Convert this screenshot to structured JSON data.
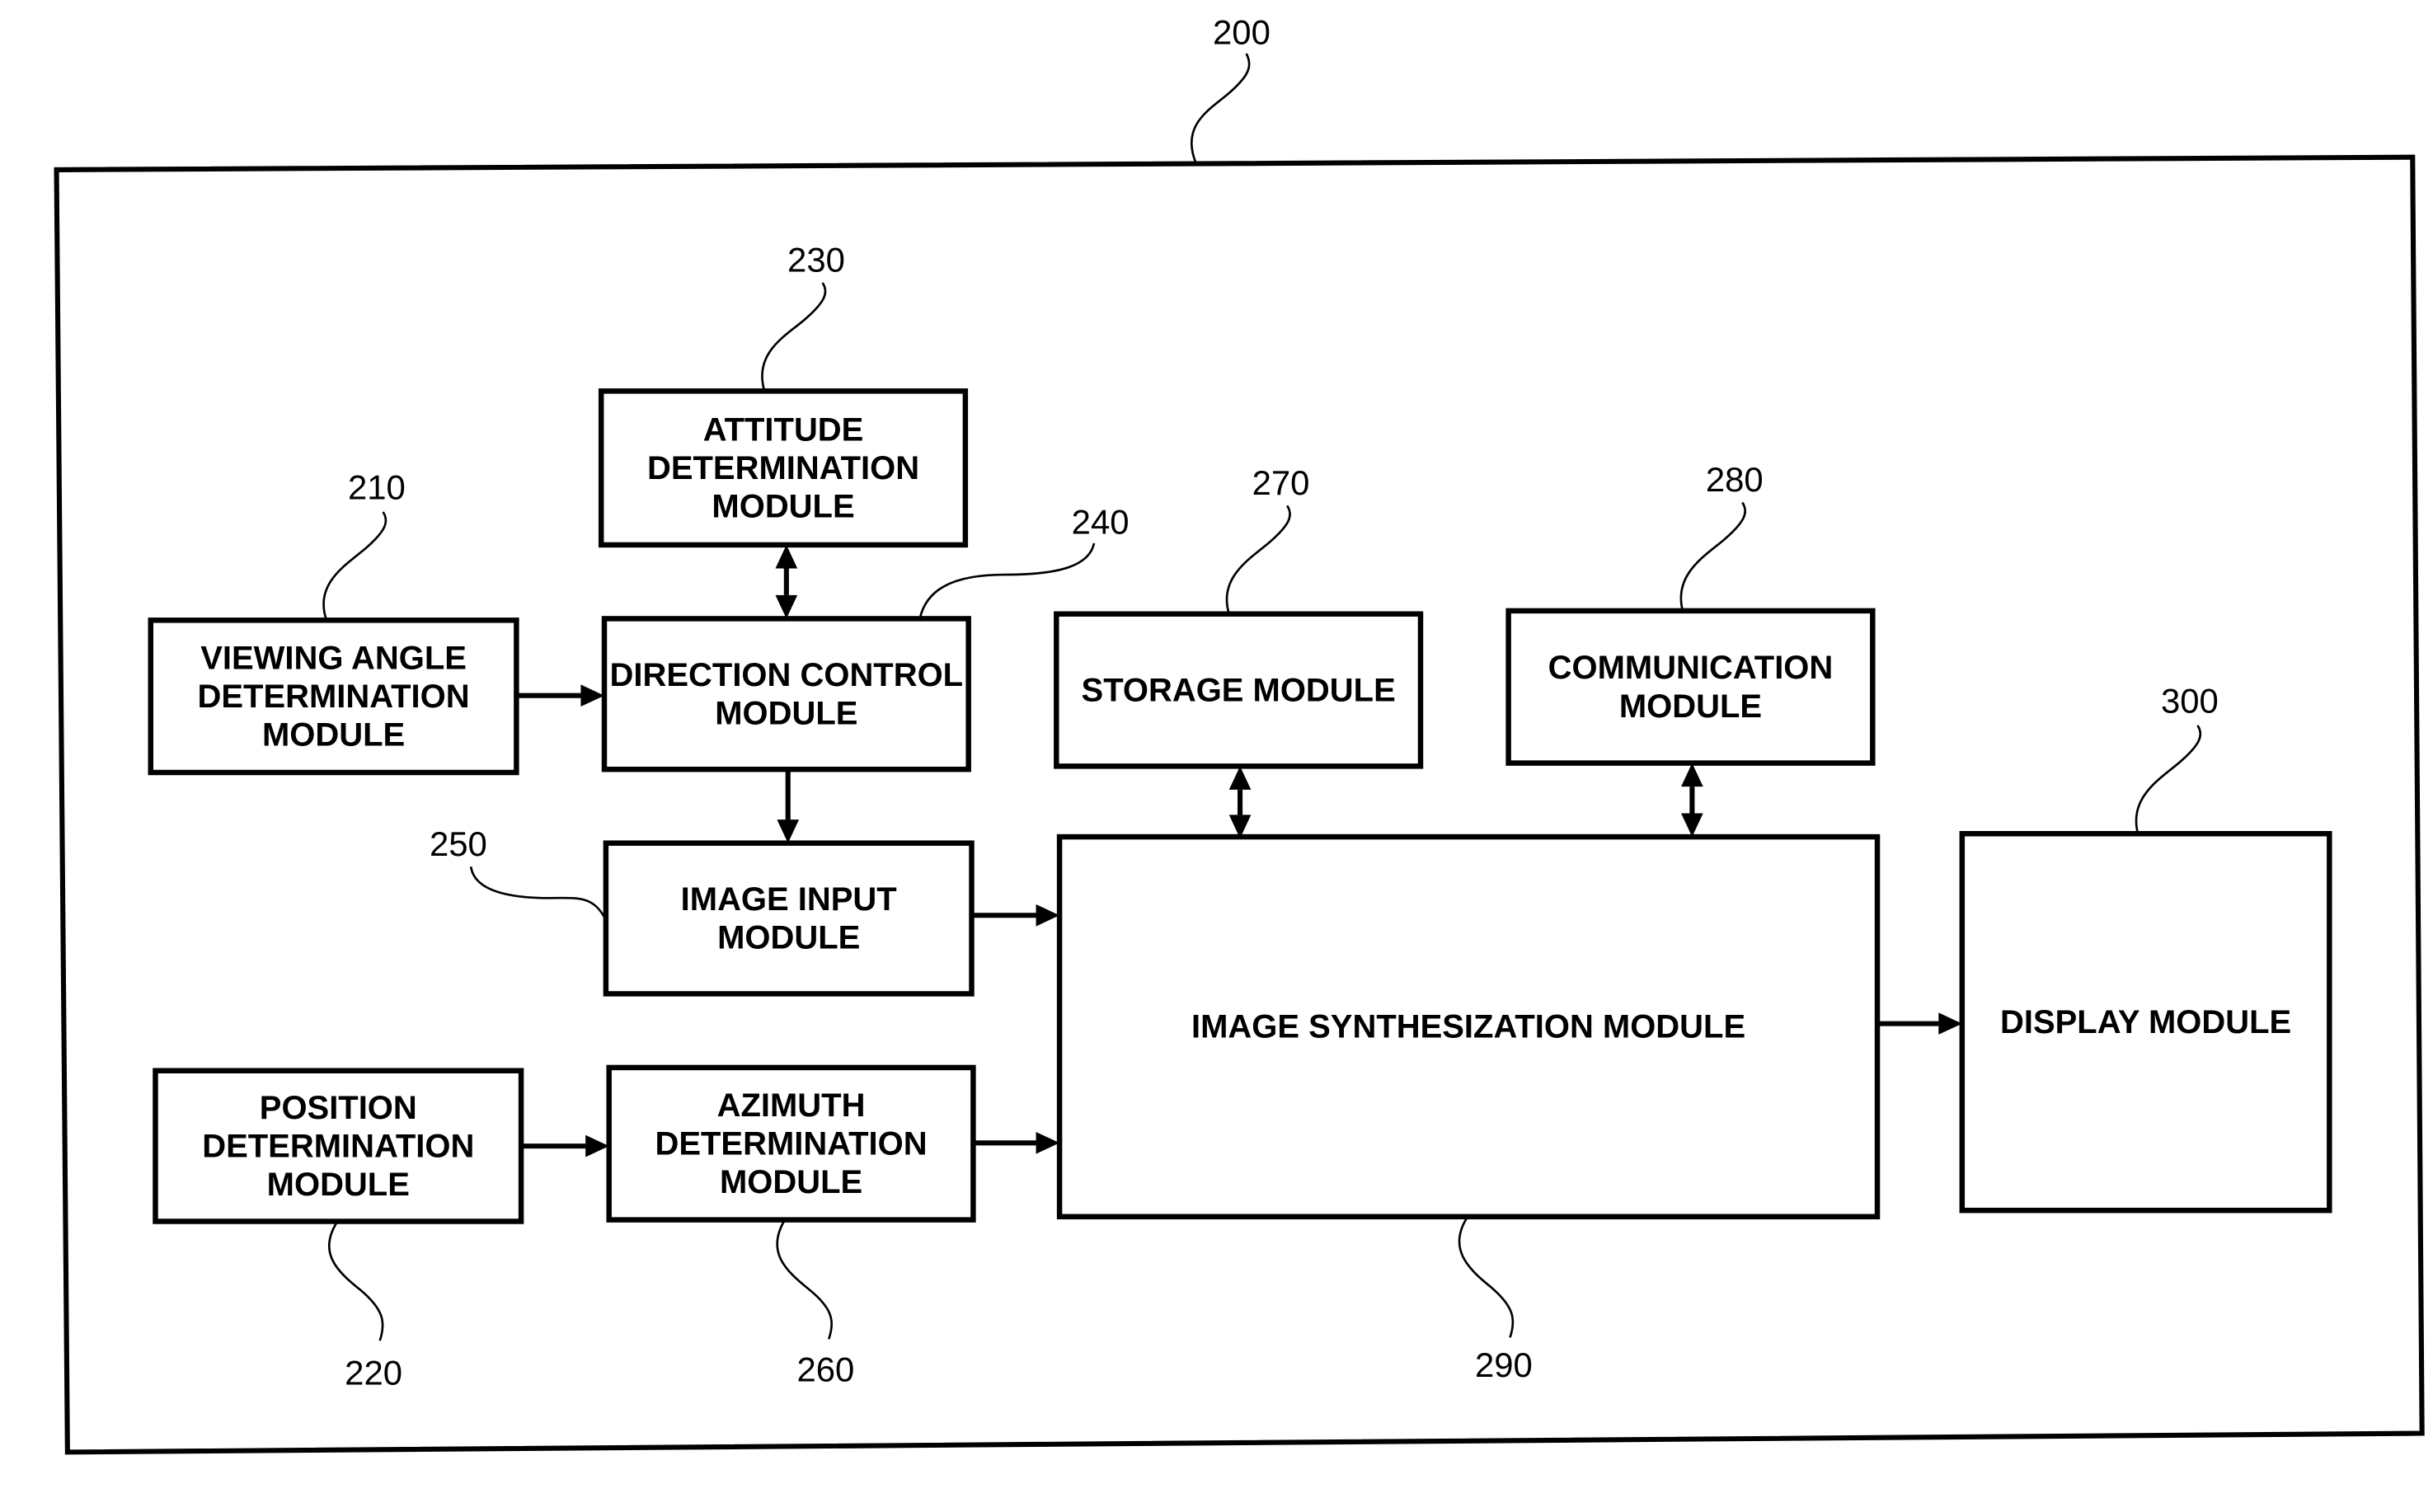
{
  "diagram": {
    "type": "block-diagram",
    "system": {
      "ref": "200"
    },
    "modules": [
      {
        "id": "attitude",
        "ref": "230",
        "lines": [
          "ATTITUDE",
          "DETERMINATION",
          "MODULE"
        ]
      },
      {
        "id": "viewing-angle",
        "ref": "210",
        "lines": [
          "VIEWING ANGLE",
          "DETERMINATION",
          "MODULE"
        ]
      },
      {
        "id": "direction-control",
        "ref": "240",
        "lines": [
          "DIRECTION CONTROL",
          "MODULE"
        ]
      },
      {
        "id": "storage",
        "ref": "270",
        "lines": [
          "STORAGE MODULE"
        ]
      },
      {
        "id": "communication",
        "ref": "280",
        "lines": [
          "COMMUNICATION",
          "MODULE"
        ]
      },
      {
        "id": "image-input",
        "ref": "250",
        "lines": [
          "IMAGE INPUT",
          "MODULE"
        ]
      },
      {
        "id": "image-synthesization",
        "ref": "290",
        "lines": [
          "IMAGE SYNTHESIZATION MODULE"
        ]
      },
      {
        "id": "display",
        "ref": "300",
        "lines": [
          "DISPLAY MODULE"
        ]
      },
      {
        "id": "position",
        "ref": "220",
        "lines": [
          "POSITION",
          "DETERMINATION",
          "MODULE"
        ]
      },
      {
        "id": "azimuth",
        "ref": "260",
        "lines": [
          "AZIMUTH",
          "DETERMINATION",
          "MODULE"
        ]
      }
    ],
    "connections": [
      {
        "from": "attitude",
        "to": "direction-control",
        "direction": "bidirectional"
      },
      {
        "from": "viewing-angle",
        "to": "direction-control",
        "direction": "forward"
      },
      {
        "from": "direction-control",
        "to": "image-input",
        "direction": "forward"
      },
      {
        "from": "storage",
        "to": "image-synthesization",
        "direction": "bidirectional"
      },
      {
        "from": "communication",
        "to": "image-synthesization",
        "direction": "bidirectional"
      },
      {
        "from": "image-input",
        "to": "image-synthesization",
        "direction": "forward"
      },
      {
        "from": "position",
        "to": "azimuth",
        "direction": "forward"
      },
      {
        "from": "azimuth",
        "to": "image-synthesization",
        "direction": "forward"
      },
      {
        "from": "image-synthesization",
        "to": "display",
        "direction": "forward"
      }
    ]
  }
}
